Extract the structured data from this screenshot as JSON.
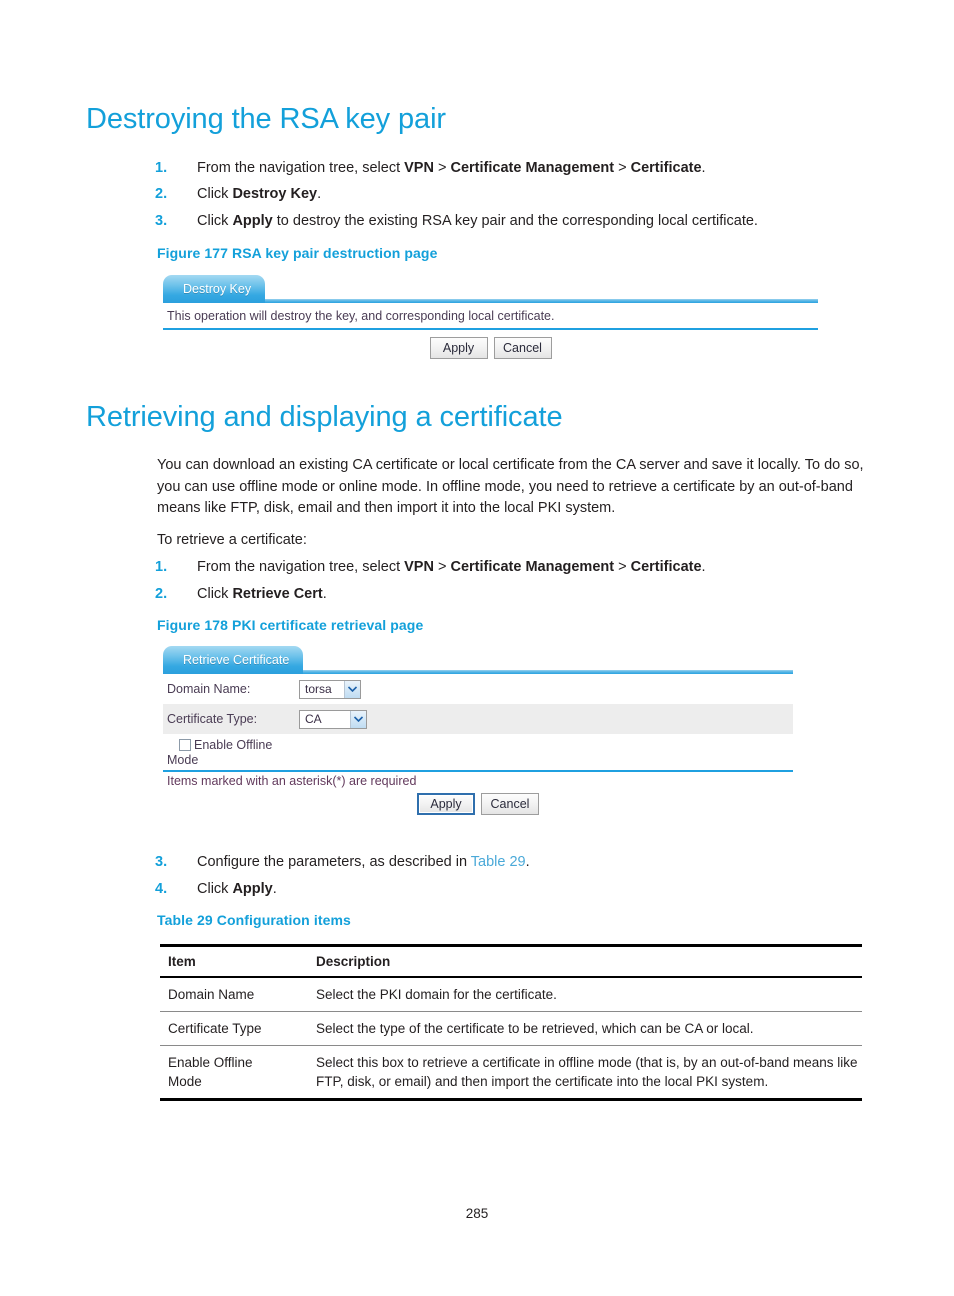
{
  "page": {
    "number": "285"
  },
  "sections": {
    "destroy": {
      "heading": "Destroying the RSA key pair",
      "steps": [
        {
          "num": "1.",
          "prefix": "From the navigation tree, select ",
          "b1": "VPN",
          "sep1": " > ",
          "b2": "Certificate Management",
          "sep2": " > ",
          "b3": "Certificate",
          "suffix": "."
        },
        {
          "num": "2.",
          "prefix": "Click ",
          "b1": "Destroy Key",
          "suffix": "."
        },
        {
          "num": "3.",
          "prefix": "Click ",
          "b1": "Apply",
          "suffix": " to destroy the existing RSA key pair and the corresponding local certificate."
        }
      ],
      "figure": {
        "caption": "Figure 177 RSA key pair destruction page",
        "tab_label": "Destroy Key",
        "note": "This operation will destroy the key, and corresponding local certificate.",
        "apply_label": "Apply",
        "cancel_label": "Cancel"
      }
    },
    "retrieve": {
      "heading": "Retrieving and displaying a certificate",
      "paragraph1": "You can download an existing CA certificate or local certificate from the CA server and save it locally. To do so, you can use offline mode or online mode. In offline mode, you need to retrieve a certificate by an out-of-band means like FTP, disk, email and then import it into the local PKI system.",
      "paragraph2": "To retrieve a certificate:",
      "steps": [
        {
          "num": "1.",
          "prefix": "From the navigation tree, select ",
          "b1": "VPN",
          "sep1": " > ",
          "b2": "Certificate Management",
          "sep2": " > ",
          "b3": "Certificate",
          "suffix": "."
        },
        {
          "num": "2.",
          "prefix": "Click ",
          "b1": "Retrieve Cert",
          "suffix": "."
        }
      ],
      "steps_after": [
        {
          "num": "3.",
          "prefix": "Configure the parameters, as described in ",
          "link": "Table 29",
          "suffix": "."
        },
        {
          "num": "4.",
          "prefix": "Click ",
          "b1": "Apply",
          "suffix": "."
        }
      ],
      "figure": {
        "caption": "Figure 178 PKI certificate retrieval page",
        "tab_label": "Retrieve Certificate",
        "fields": [
          {
            "label": "Domain Name:",
            "value": "torsa"
          },
          {
            "label": "Certificate Type:",
            "value": "CA"
          }
        ],
        "checkbox_label_line1": "Enable Offline",
        "checkbox_label_line2": "Mode",
        "checkbox_checked": false,
        "required_note": "Items marked with an asterisk(*) are required",
        "apply_label": "Apply",
        "cancel_label": "Cancel"
      }
    }
  },
  "table": {
    "caption": "Table 29 Configuration items",
    "headers": [
      "Item",
      "Description"
    ],
    "rows": [
      {
        "item": "Domain Name",
        "description": "Select the PKI domain for the certificate."
      },
      {
        "item": "Certificate Type",
        "description": "Select the type of the certificate to be retrieved, which can be CA or local."
      },
      {
        "item": "Enable Offline Mode",
        "item_line1": "Enable Offline",
        "item_line2": "Mode",
        "description": "Select this box to retrieve a certificate in offline mode (that is, by an out-of-band means like FTP, disk, or email) and then import the certificate into the local PKI system."
      }
    ]
  },
  "colors": {
    "heading_blue": "#13a0da",
    "link_blue": "#4aa9d8",
    "ui_rule_blue": "#1fa0e0",
    "alt_row_gray": "#ededed"
  }
}
